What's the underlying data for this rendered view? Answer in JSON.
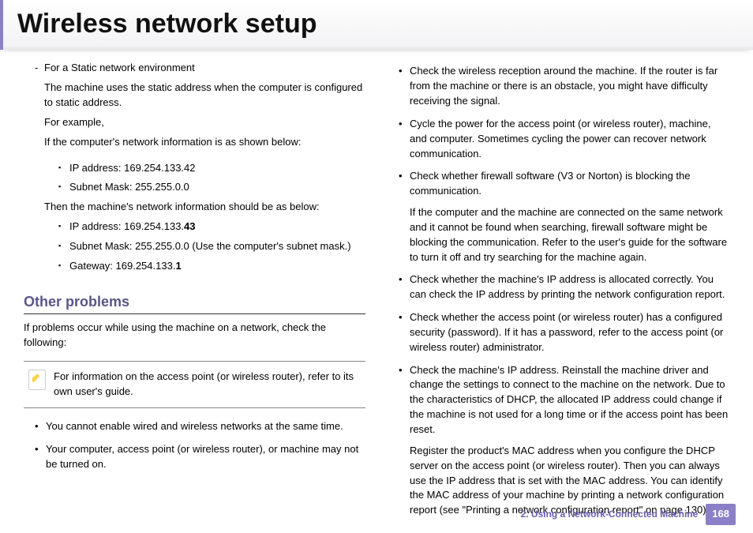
{
  "header": {
    "title": "Wireless network setup"
  },
  "left": {
    "dash_label": "For a Static network environment",
    "dash_body": "The machine uses the static address when the computer is configured to static address.",
    "for_example": "For example,",
    "if_line": "If the computer's network information is as shown below:",
    "comp_ip": "IP address: 169.254.133.42",
    "comp_mask": "Subnet Mask: 255.255.0.0",
    "then_line": "Then the machine's network information should be as below:",
    "mach_ip_pre": "IP address: 169.254.133.",
    "mach_ip_bold": "43",
    "mach_mask": "Subnet Mask: 255.255.0.0 (Use the computer's subnet mask.)",
    "mach_gw_pre": "Gateway: 169.254.133.",
    "mach_gw_bold": "1",
    "h2": "Other problems",
    "intro": "If problems occur while using the machine on a network, check the following:",
    "note": "For information on the access point (or wireless router), refer to its own user's guide.",
    "b1": "You cannot enable wired and wireless networks at the same time.",
    "b2": "Your computer, access point (or wireless router), or machine may not be turned on."
  },
  "right": {
    "r1": "Check the wireless reception around the machine. If the router is far from the machine or there is an obstacle, you might have difficulty receiving the signal.",
    "r2": "Cycle the power for the access point (or wireless router), machine, and computer. Sometimes cycling the power can recover network communication.",
    "r3": "Check whether firewall software (V3 or Norton) is blocking the communication.",
    "r3b": "If the computer and the machine are connected on the same network and it cannot be found when searching, firewall software might be blocking the communication. Refer to the user's guide for the software to turn it off and try searching for the machine again.",
    "r4": "Check whether the machine's IP address is allocated correctly. You can check the IP address by printing the network configuration report.",
    "r5": "Check whether the access point (or wireless router) has a configured security (password). If it has a password, refer to the access point (or wireless router) administrator.",
    "r6": "Check the machine's IP address. Reinstall the machine driver and change the settings to connect to the machine on the network. Due to the characteristics of DHCP, the allocated IP address could change if the machine is not used for a long time or if the access point has been reset.",
    "r6b": "Register the product's MAC address when you configure the DHCP server on the access point (or wireless router). Then you can always use the IP address that is set with the MAC address. You can identify the MAC address of your machine by printing a network configuration report (see \"Printing a network configuration report\" on page 130)."
  },
  "footer": {
    "chapter": "2.  Using a Network-Connected Machine",
    "page": "168"
  }
}
